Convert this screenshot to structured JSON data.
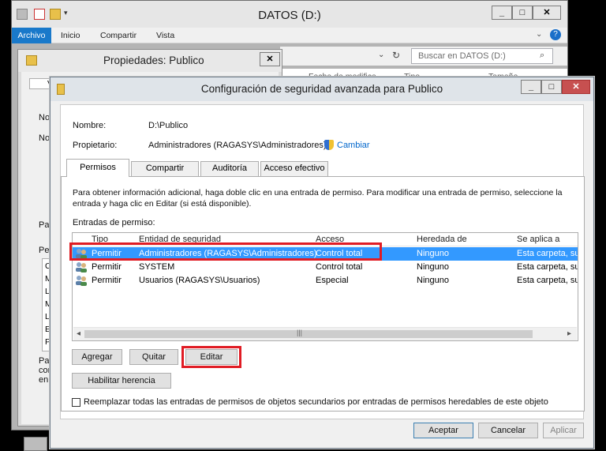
{
  "explorer": {
    "title": "DATOS (D:)",
    "ribbon_tabs": [
      "Archivo",
      "Inicio",
      "Compartir",
      "Vista"
    ],
    "search_placeholder": "Buscar en DATOS (D:)",
    "columns": [
      "Fecha de modifica...",
      "Tipo",
      "Tamaño"
    ]
  },
  "props": {
    "title": "Propiedades: Publico",
    "side_fragments": [
      "V",
      "Nom",
      "Nor",
      "Par",
      "Per",
      "C",
      "M",
      "L",
      "M",
      "L",
      "E",
      "P",
      "Para",
      "con",
      "en C"
    ]
  },
  "adv": {
    "title": "Configuración de seguridad avanzada para Publico",
    "name_label": "Nombre:",
    "name_value": "D:\\Publico",
    "owner_label": "Propietario:",
    "owner_value": "Administradores (RAGASYS\\Administradores)",
    "change_link": "Cambiar",
    "tabs": [
      "Permisos",
      "Compartir",
      "Auditoría",
      "Acceso efectivo"
    ],
    "info_text": "Para obtener información adicional, haga doble clic en una entrada de permiso. Para modificar una entrada de permiso, seleccione la entrada y haga clic en Editar (si está disponible).",
    "entries_label": "Entradas de permiso:",
    "columns": [
      "Tipo",
      "Entidad de seguridad",
      "Acceso",
      "Heredada de",
      "Se aplica a"
    ],
    "rows": [
      {
        "type": "Permitir",
        "entity": "Administradores (RAGASYS\\Administradores)",
        "access": "Control total",
        "inherited": "Ninguno",
        "applies": "Esta carpeta, sub"
      },
      {
        "type": "Permitir",
        "entity": "SYSTEM",
        "access": "Control total",
        "inherited": "Ninguno",
        "applies": "Esta carpeta, sub"
      },
      {
        "type": "Permitir",
        "entity": "Usuarios (RAGASYS\\Usuarios)",
        "access": "Especial",
        "inherited": "Ninguno",
        "applies": "Esta carpeta, sub"
      }
    ],
    "btn_add": "Agregar",
    "btn_remove": "Quitar",
    "btn_edit": "Editar",
    "btn_enable_inheritance": "Habilitar herencia",
    "replace_checkbox_label": "Reemplazar todas las entradas de permisos de objetos secundarios por entradas de permisos heredables de este objeto",
    "replace_checked": false,
    "btn_ok": "Aceptar",
    "btn_cancel": "Cancelar",
    "btn_apply": "Aplicar"
  },
  "colors": {
    "selection": "#3399ff",
    "highlight_box": "#e01c24",
    "link": "#0066cc"
  }
}
